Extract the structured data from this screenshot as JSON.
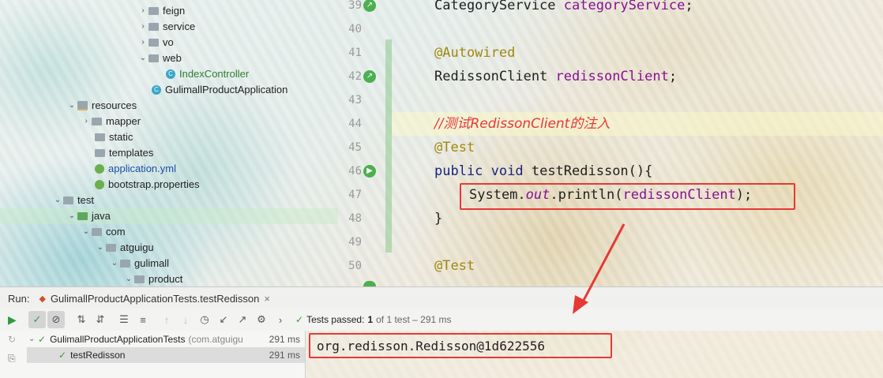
{
  "tree": {
    "items": [
      {
        "label": "feign",
        "type": "folder",
        "indent": 174,
        "arrow": "›"
      },
      {
        "label": "service",
        "type": "folder",
        "indent": 174,
        "arrow": "›"
      },
      {
        "label": "vo",
        "type": "folder",
        "indent": 174,
        "arrow": "›"
      },
      {
        "label": "web",
        "type": "folder",
        "indent": 174,
        "arrow": "⌄"
      },
      {
        "label": "IndexController",
        "type": "class",
        "indent": 208,
        "arrow": ""
      },
      {
        "label": "GulimallProductApplication",
        "type": "class",
        "indent": 190,
        "arrow": ""
      },
      {
        "label": "resources",
        "type": "resfolder",
        "indent": 84,
        "arrow": "⌄"
      },
      {
        "label": "mapper",
        "type": "folder",
        "indent": 102,
        "arrow": "›"
      },
      {
        "label": "static",
        "type": "folder",
        "indent": 102,
        "arrow": ""
      },
      {
        "label": "templates",
        "type": "folder",
        "indent": 102,
        "arrow": ""
      },
      {
        "label": "application.yml",
        "type": "leaf",
        "indent": 118,
        "arrow": ""
      },
      {
        "label": "bootstrap.properties",
        "type": "leaf",
        "indent": 118,
        "arrow": ""
      },
      {
        "label": "test",
        "type": "folder",
        "indent": 66,
        "arrow": "⌄"
      },
      {
        "label": "java",
        "type": "javafolder",
        "indent": 84,
        "arrow": "⌄"
      },
      {
        "label": "com",
        "type": "folder",
        "indent": 102,
        "arrow": "⌄"
      },
      {
        "label": "atguigu",
        "type": "folder",
        "indent": 120,
        "arrow": "⌄"
      },
      {
        "label": "gulimall",
        "type": "folder",
        "indent": 138,
        "arrow": "⌄"
      },
      {
        "label": "product",
        "type": "folder",
        "indent": 156,
        "arrow": "⌄"
      }
    ]
  },
  "editor": {
    "line_numbers": [
      "39",
      "40",
      "41",
      "42",
      "43",
      "44",
      "45",
      "46",
      "47",
      "48",
      "49",
      "50"
    ],
    "line39_type": "CategoryService",
    "line39_field": "categoryService",
    "line41_ann": "@Autowired",
    "line42_type": "RedissonClient",
    "line42_field": "redissonClient",
    "line44_comment": "//测试RedissonClient的注入",
    "line45_ann": "@Test",
    "line46_kw": "public void",
    "line46_name": "testRedisson(){",
    "line47_a": "System.",
    "line47_out": "out",
    "line47_b": ".println(",
    "line47_arg": "redissonClient",
    "line47_c": ");",
    "line48": "}",
    "line50_ann": "@Test"
  },
  "run": {
    "label": "Run:",
    "tab_title": "GulimallProductApplicationTests.testRedisson",
    "tab_close": "×",
    "status_prefix": "Tests passed:",
    "status_count": "1",
    "status_rest": "of 1 test – 291 ms",
    "tests": [
      {
        "name": "GulimallProductApplicationTests",
        "pkg": "(com.atguigu",
        "time": "291 ms"
      },
      {
        "name": "testRedisson",
        "pkg": "",
        "time": "291 ms"
      }
    ],
    "console_output": "org.redisson.Redisson@1d622556"
  },
  "colors": {
    "accent_red": "#e53935",
    "pass_green": "#3a9a3a"
  }
}
